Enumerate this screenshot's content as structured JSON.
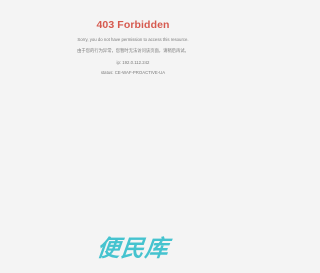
{
  "error": {
    "title": "403 Forbidden",
    "message_en": "Sorry, you do not have permission to access this resource.",
    "message_zh": "由于您的行为异常，您暂时无法访问该页面，请稍后再试。",
    "ip_line": "ip: 192.0.112.242",
    "status_line": "status: CE-WAF-PROACTIVE-UA"
  },
  "watermark": {
    "text": "便民库"
  },
  "colors": {
    "background": "#f4f4f4",
    "title": "#d65a4f",
    "body_text": "#7a7a7a",
    "watermark": "#45c3cf"
  }
}
